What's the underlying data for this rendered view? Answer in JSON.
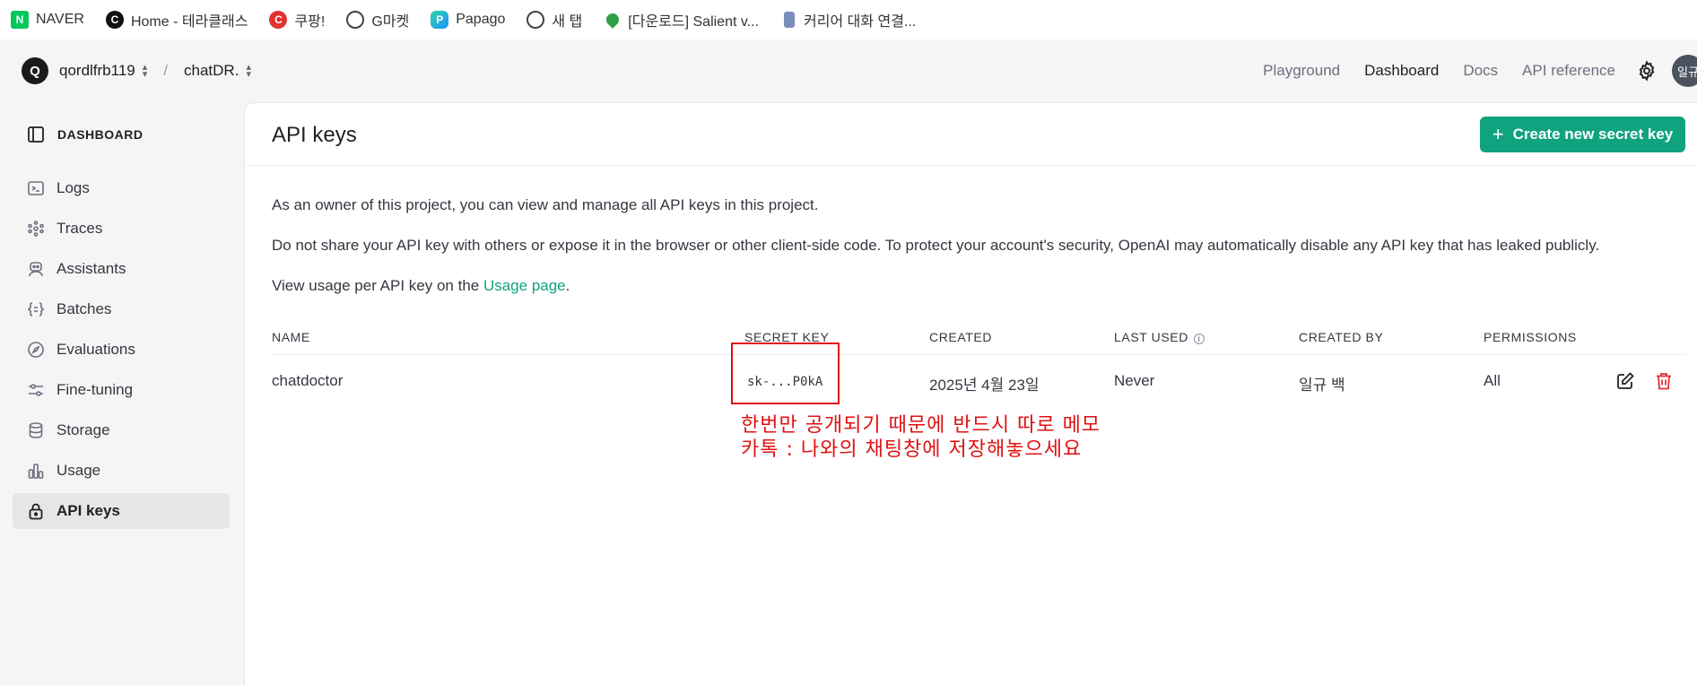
{
  "bookmarks": [
    {
      "label": "NAVER",
      "icon": "naver-icon",
      "glyph": "N"
    },
    {
      "label": "Home - 테라클래스",
      "icon": "terraclass-icon",
      "glyph": "C"
    },
    {
      "label": "쿠팡!",
      "icon": "coupang-icon",
      "glyph": "C"
    },
    {
      "label": "G마켓",
      "icon": "globe-icon",
      "glyph": ""
    },
    {
      "label": "Papago",
      "icon": "papago-icon",
      "glyph": "P"
    },
    {
      "label": "새 탭",
      "icon": "globe-icon",
      "glyph": ""
    },
    {
      "label": "[다운로드] Salient v...",
      "icon": "drop-icon",
      "glyph": ""
    },
    {
      "label": "커리어 대화 연결...",
      "icon": "jar-icon",
      "glyph": ""
    }
  ],
  "header": {
    "org_initial": "Q",
    "org_name": "qordlfrb119",
    "separator": "/",
    "project_name": "chatDR.",
    "nav": [
      "Playground",
      "Dashboard",
      "Docs",
      "API reference"
    ],
    "active_nav": "Dashboard",
    "user_avatar": "일규"
  },
  "sidebar": {
    "heading": "DASHBOARD",
    "items": [
      {
        "label": "Logs",
        "icon": "terminal-icon"
      },
      {
        "label": "Traces",
        "icon": "traces-icon"
      },
      {
        "label": "Assistants",
        "icon": "robot-icon"
      },
      {
        "label": "Batches",
        "icon": "braces-icon"
      },
      {
        "label": "Evaluations",
        "icon": "compass-icon"
      },
      {
        "label": "Fine-tuning",
        "icon": "sliders-icon"
      },
      {
        "label": "Storage",
        "icon": "database-icon"
      },
      {
        "label": "Usage",
        "icon": "bar-chart-icon"
      },
      {
        "label": "API keys",
        "icon": "lock-icon",
        "active": true
      }
    ]
  },
  "main": {
    "title": "API keys",
    "create_button": "Create new secret key",
    "create_button_icon": "+",
    "para1": "As an owner of this project, you can view and manage all API keys in this project.",
    "para2": "Do not share your API key with others or expose it in the browser or other client-side code. To protect your account's security, OpenAI may automatically disable any API key that has leaked publicly.",
    "para3_prefix": "View usage per API key on the ",
    "para3_link": "Usage page",
    "para3_suffix": ".",
    "info_glyph": "i",
    "table": {
      "headers": [
        "NAME",
        "SECRET KEY",
        "CREATED",
        "LAST USED",
        "CREATED BY",
        "PERMISSIONS"
      ],
      "rows": [
        {
          "name": "chatdoctor",
          "secret_key": "sk-...P0kA",
          "created": "2025년 4월 23일",
          "last_used": "Never",
          "created_by": "일규 백",
          "permissions": "All"
        }
      ]
    }
  },
  "annotation": {
    "line1": "한번만 공개되기 때문에 반드시 따로 메모",
    "line2": "카톡 : 나와의 채팅창에 저장해놓으세요",
    "color": "#e01010"
  },
  "colors": {
    "accent": "#10a37f",
    "delete": "#e03131"
  }
}
